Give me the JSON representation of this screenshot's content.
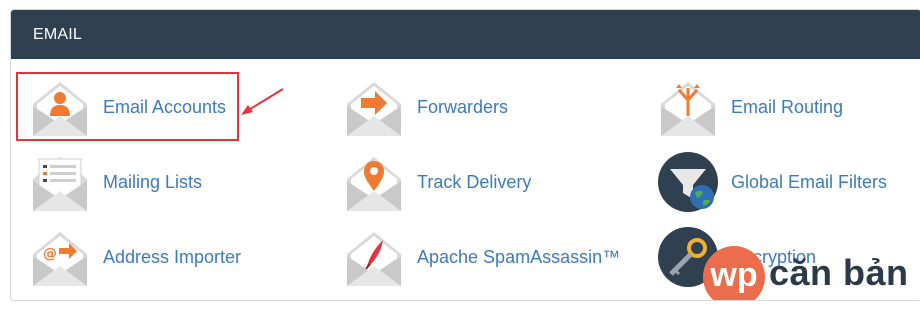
{
  "panel": {
    "title": "EMAIL"
  },
  "items": [
    {
      "label": "Email Accounts",
      "icon": "email-accounts-icon"
    },
    {
      "label": "Forwarders",
      "icon": "forwarders-icon"
    },
    {
      "label": "Email Routing",
      "icon": "email-routing-icon"
    },
    {
      "label": "Mailing Lists",
      "icon": "mailing-lists-icon"
    },
    {
      "label": "Track Delivery",
      "icon": "track-delivery-icon"
    },
    {
      "label": "Global Email Filters",
      "icon": "global-email-filters-icon"
    },
    {
      "label": "Address Importer",
      "icon": "address-importer-icon"
    },
    {
      "label": "Apache SpamAssassin™",
      "icon": "spamassassin-icon"
    },
    {
      "label": "Encryption",
      "icon": "encryption-icon"
    }
  ],
  "watermark": {
    "logo_text": "wp",
    "brand_text": "căn bản"
  },
  "colors": {
    "header": "#2f4051",
    "link": "#3c7bbd",
    "accent": "#f07a2f",
    "highlight": "#e5323b"
  }
}
